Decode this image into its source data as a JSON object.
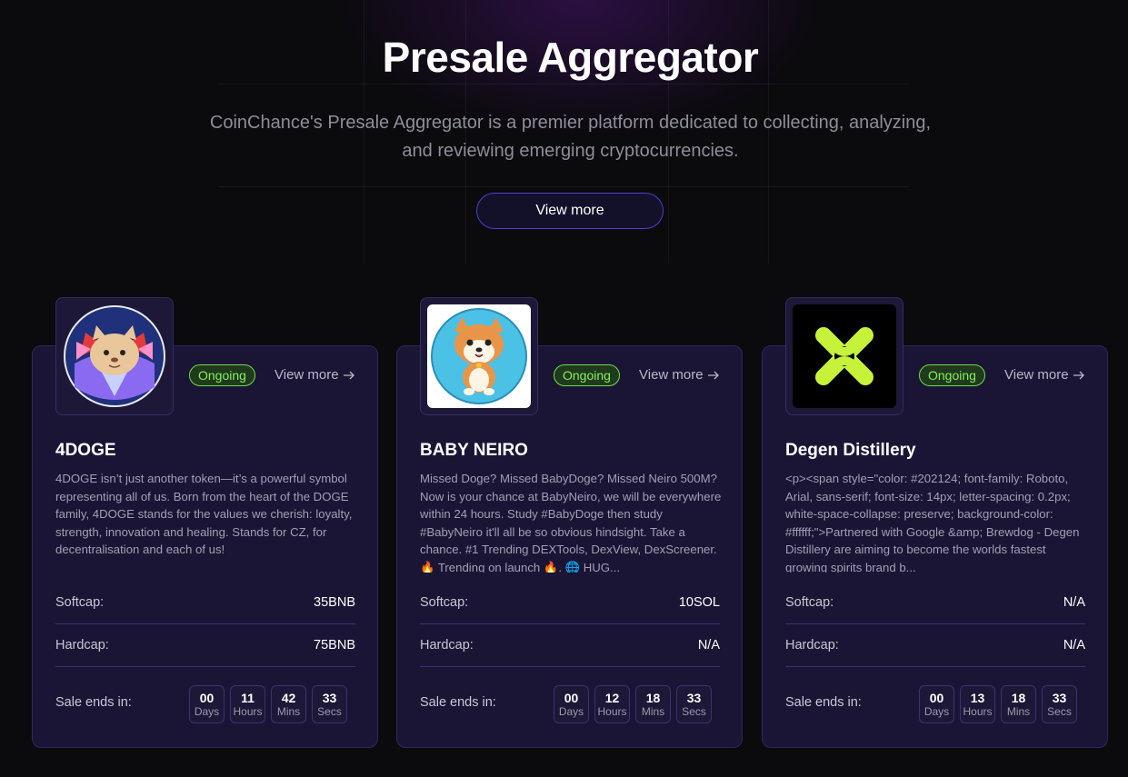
{
  "hero": {
    "title": "Presale Aggregator",
    "description": "CoinChance's Presale Aggregator is a premier platform dedicated to collecting, analyzing, and reviewing emerging cryptocurrencies.",
    "view_more": "View more"
  },
  "cards": [
    {
      "name": "4DOGE",
      "status": "Ongoing",
      "view_more": "View more",
      "description": "4DOGE isn’t just another token—it’s a powerful symbol representing all of us. Born from the heart of the DOGE family, 4DOGE stands for the values we cherish: loyalty, strength, innovation and healing. Stands for CZ, for decentralisation and each of us!",
      "softcap_label": "Softcap:",
      "softcap": "35BNB",
      "hardcap_label": "Hardcap:",
      "hardcap": "75BNB",
      "ends_label": "Sale ends in:",
      "timer": {
        "days": "00",
        "hours": "11",
        "mins": "42",
        "secs": "33"
      }
    },
    {
      "name": "BABY NEIRO",
      "status": "Ongoing",
      "view_more": "View more",
      "description": "Missed Doge? Missed BabyDoge? Missed Neiro 500M? Now is your chance at BabyNeiro, we will be everywhere within 24 hours. Study #BabyDoge then study #BabyNeiro it'll all be so obvious hindsight. Take a chance. #1 Trending DEXTools, DexView, DexScreener. 🔥 Trending on launch 🔥. 🌐 HUG...",
      "softcap_label": "Softcap:",
      "softcap": "10SOL",
      "hardcap_label": "Hardcap:",
      "hardcap": "N/A",
      "ends_label": "Sale ends in:",
      "timer": {
        "days": "00",
        "hours": "12",
        "mins": "18",
        "secs": "33"
      }
    },
    {
      "name": "Degen Distillery",
      "status": "Ongoing",
      "view_more": "View more",
      "description": "<p><span style=\"color: #202124; font-family: Roboto, Arial, sans-serif; font-size: 14px; letter-spacing: 0.2px; white-space-collapse: preserve; background-color: #ffffff;\">Partnered with Google &amp; Brewdog - Degen Distillery are aiming to become the worlds fastest growing spirits brand b...",
      "softcap_label": "Softcap:",
      "softcap": "N/A",
      "hardcap_label": "Hardcap:",
      "hardcap": "N/A",
      "ends_label": "Sale ends in:",
      "timer": {
        "days": "00",
        "hours": "13",
        "mins": "18",
        "secs": "33"
      }
    }
  ],
  "timer_units": {
    "days": "Days",
    "hours": "Hours",
    "mins": "Mins",
    "secs": "Secs"
  },
  "icons": {
    "arrow": "arrow-right-icon",
    "card1_logo": "doge-cat-logo",
    "card2_logo": "shiba-dog-logo",
    "card3_logo": "x-logo"
  },
  "colors": {
    "accent": "#4a3fd1",
    "status_green": "#86ef5b",
    "card_bg": "#1b1535"
  }
}
